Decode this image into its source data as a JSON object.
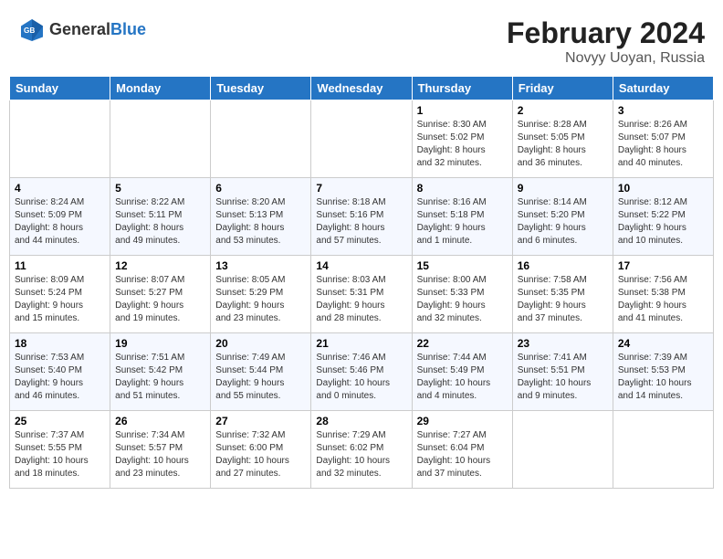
{
  "header": {
    "logo_text_general": "General",
    "logo_text_blue": "Blue",
    "main_title": "February 2024",
    "sub_title": "Novyy Uoyan, Russia"
  },
  "weekdays": [
    "Sunday",
    "Monday",
    "Tuesday",
    "Wednesday",
    "Thursday",
    "Friday",
    "Saturday"
  ],
  "weeks": [
    [
      {
        "day": "",
        "info": ""
      },
      {
        "day": "",
        "info": ""
      },
      {
        "day": "",
        "info": ""
      },
      {
        "day": "",
        "info": ""
      },
      {
        "day": "1",
        "info": "Sunrise: 8:30 AM\nSunset: 5:02 PM\nDaylight: 8 hours\nand 32 minutes."
      },
      {
        "day": "2",
        "info": "Sunrise: 8:28 AM\nSunset: 5:05 PM\nDaylight: 8 hours\nand 36 minutes."
      },
      {
        "day": "3",
        "info": "Sunrise: 8:26 AM\nSunset: 5:07 PM\nDaylight: 8 hours\nand 40 minutes."
      }
    ],
    [
      {
        "day": "4",
        "info": "Sunrise: 8:24 AM\nSunset: 5:09 PM\nDaylight: 8 hours\nand 44 minutes."
      },
      {
        "day": "5",
        "info": "Sunrise: 8:22 AM\nSunset: 5:11 PM\nDaylight: 8 hours\nand 49 minutes."
      },
      {
        "day": "6",
        "info": "Sunrise: 8:20 AM\nSunset: 5:13 PM\nDaylight: 8 hours\nand 53 minutes."
      },
      {
        "day": "7",
        "info": "Sunrise: 8:18 AM\nSunset: 5:16 PM\nDaylight: 8 hours\nand 57 minutes."
      },
      {
        "day": "8",
        "info": "Sunrise: 8:16 AM\nSunset: 5:18 PM\nDaylight: 9 hours\nand 1 minute."
      },
      {
        "day": "9",
        "info": "Sunrise: 8:14 AM\nSunset: 5:20 PM\nDaylight: 9 hours\nand 6 minutes."
      },
      {
        "day": "10",
        "info": "Sunrise: 8:12 AM\nSunset: 5:22 PM\nDaylight: 9 hours\nand 10 minutes."
      }
    ],
    [
      {
        "day": "11",
        "info": "Sunrise: 8:09 AM\nSunset: 5:24 PM\nDaylight: 9 hours\nand 15 minutes."
      },
      {
        "day": "12",
        "info": "Sunrise: 8:07 AM\nSunset: 5:27 PM\nDaylight: 9 hours\nand 19 minutes."
      },
      {
        "day": "13",
        "info": "Sunrise: 8:05 AM\nSunset: 5:29 PM\nDaylight: 9 hours\nand 23 minutes."
      },
      {
        "day": "14",
        "info": "Sunrise: 8:03 AM\nSunset: 5:31 PM\nDaylight: 9 hours\nand 28 minutes."
      },
      {
        "day": "15",
        "info": "Sunrise: 8:00 AM\nSunset: 5:33 PM\nDaylight: 9 hours\nand 32 minutes."
      },
      {
        "day": "16",
        "info": "Sunrise: 7:58 AM\nSunset: 5:35 PM\nDaylight: 9 hours\nand 37 minutes."
      },
      {
        "day": "17",
        "info": "Sunrise: 7:56 AM\nSunset: 5:38 PM\nDaylight: 9 hours\nand 41 minutes."
      }
    ],
    [
      {
        "day": "18",
        "info": "Sunrise: 7:53 AM\nSunset: 5:40 PM\nDaylight: 9 hours\nand 46 minutes."
      },
      {
        "day": "19",
        "info": "Sunrise: 7:51 AM\nSunset: 5:42 PM\nDaylight: 9 hours\nand 51 minutes."
      },
      {
        "day": "20",
        "info": "Sunrise: 7:49 AM\nSunset: 5:44 PM\nDaylight: 9 hours\nand 55 minutes."
      },
      {
        "day": "21",
        "info": "Sunrise: 7:46 AM\nSunset: 5:46 PM\nDaylight: 10 hours\nand 0 minutes."
      },
      {
        "day": "22",
        "info": "Sunrise: 7:44 AM\nSunset: 5:49 PM\nDaylight: 10 hours\nand 4 minutes."
      },
      {
        "day": "23",
        "info": "Sunrise: 7:41 AM\nSunset: 5:51 PM\nDaylight: 10 hours\nand 9 minutes."
      },
      {
        "day": "24",
        "info": "Sunrise: 7:39 AM\nSunset: 5:53 PM\nDaylight: 10 hours\nand 14 minutes."
      }
    ],
    [
      {
        "day": "25",
        "info": "Sunrise: 7:37 AM\nSunset: 5:55 PM\nDaylight: 10 hours\nand 18 minutes."
      },
      {
        "day": "26",
        "info": "Sunrise: 7:34 AM\nSunset: 5:57 PM\nDaylight: 10 hours\nand 23 minutes."
      },
      {
        "day": "27",
        "info": "Sunrise: 7:32 AM\nSunset: 6:00 PM\nDaylight: 10 hours\nand 27 minutes."
      },
      {
        "day": "28",
        "info": "Sunrise: 7:29 AM\nSunset: 6:02 PM\nDaylight: 10 hours\nand 32 minutes."
      },
      {
        "day": "29",
        "info": "Sunrise: 7:27 AM\nSunset: 6:04 PM\nDaylight: 10 hours\nand 37 minutes."
      },
      {
        "day": "",
        "info": ""
      },
      {
        "day": "",
        "info": ""
      }
    ]
  ]
}
